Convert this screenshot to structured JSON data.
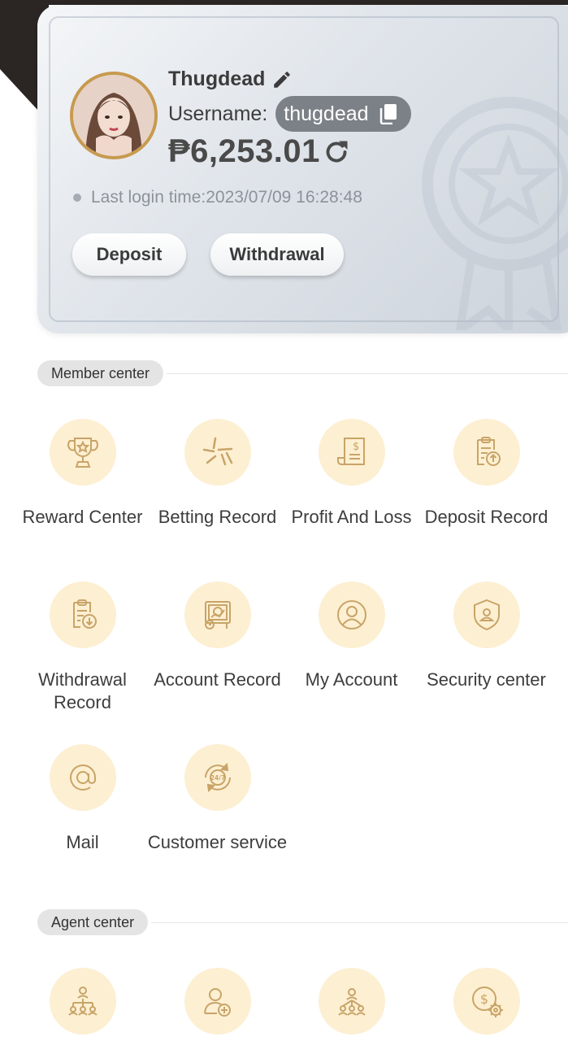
{
  "profile": {
    "name": "Thugdead",
    "username_label": "Username:",
    "username": "thugdead",
    "balance": "₱6,253.01",
    "last_login": "Last login time:2023/07/09 16:28:48",
    "deposit_label": "Deposit",
    "withdrawal_label": "Withdrawal"
  },
  "member_center": {
    "title": "Member center",
    "items": [
      {
        "label": "Reward Center",
        "icon": "trophy-icon"
      },
      {
        "label": "Betting Record",
        "icon": "betting-record-icon"
      },
      {
        "label": "Profit And Loss",
        "icon": "profit-loss-icon"
      },
      {
        "label": "Deposit Record",
        "icon": "deposit-record-icon"
      },
      {
        "label": "Withdrawal Record",
        "icon": "withdrawal-record-icon"
      },
      {
        "label": "Account Record",
        "icon": "account-record-icon"
      },
      {
        "label": "My Account",
        "icon": "my-account-icon"
      },
      {
        "label": "Security center",
        "icon": "shield-user-icon"
      },
      {
        "label": "Mail",
        "icon": "at-sign-icon"
      },
      {
        "label": "Customer service",
        "icon": "support-24-7-icon"
      }
    ]
  },
  "agent_center": {
    "title": "Agent center",
    "items": [
      {
        "icon": "hierarchy-icon"
      },
      {
        "icon": "add-user-icon"
      },
      {
        "icon": "team-icon"
      },
      {
        "icon": "commission-settings-icon"
      }
    ]
  },
  "colors": {
    "accent_icon": "#c8a468",
    "icon_bg": "#fdefd2",
    "chip_bg": "#7c8187",
    "avatar_ring": "#c79a4e"
  }
}
